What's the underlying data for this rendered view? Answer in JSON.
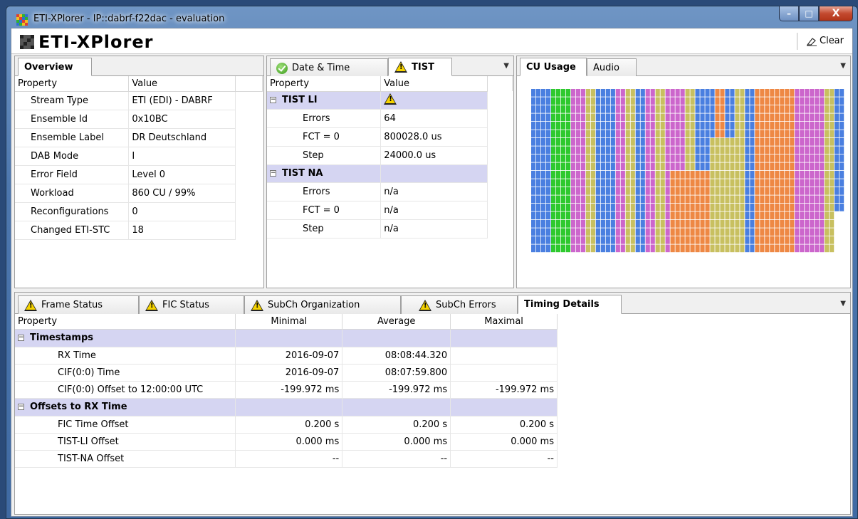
{
  "window": {
    "title": "ETI-XPlorer - IP::dabrf-f22dac - evaluation",
    "minimize": "–",
    "maximize": "□",
    "close": "X"
  },
  "header": {
    "logo_text": "ETI-XPlorer",
    "clear_label": "Clear"
  },
  "overview": {
    "tab": "Overview",
    "col_property": "Property",
    "col_value": "Value",
    "rows": [
      {
        "property": "Stream Type",
        "value": "ETI (EDI) - DABRF"
      },
      {
        "property": "Ensemble Id",
        "value": "0x10BC"
      },
      {
        "property": "Ensemble Label",
        "value": "DR Deutschland"
      },
      {
        "property": "DAB Mode",
        "value": "I"
      },
      {
        "property": "Error Field",
        "value": "Level 0"
      },
      {
        "property": "Workload",
        "value": "860 CU / 99%"
      },
      {
        "property": "Reconfigurations",
        "value": "0"
      },
      {
        "property": "Changed ETI-STC",
        "value": "18"
      }
    ]
  },
  "tist": {
    "tabs": [
      "Date & Time",
      "TIST"
    ],
    "col_property": "Property",
    "col_value": "Value",
    "group1": {
      "label": "TIST LI",
      "rows": [
        {
          "property": "Errors",
          "value": "64"
        },
        {
          "property": "FCT = 0",
          "value": "800028.0 us"
        },
        {
          "property": "Step",
          "value": "24000.0 us"
        }
      ]
    },
    "group2": {
      "label": "TIST NA",
      "rows": [
        {
          "property": "Errors",
          "value": "n/a"
        },
        {
          "property": "FCT = 0",
          "value": "n/a"
        },
        {
          "property": "Step",
          "value": "n/a"
        }
      ]
    }
  },
  "cu": {
    "tabs": [
      "CU Usage",
      "Audio"
    ],
    "colors": [
      "#4a7fe0",
      "#2ec92e",
      "#cc66cc",
      "#c8c060",
      "#ee8844",
      "#ffffff"
    ]
  },
  "timing": {
    "tabs": [
      "Frame Status",
      "FIC Status",
      "SubCh Organization",
      "SubCh Errors",
      "Timing Details"
    ],
    "columns": [
      "Property",
      "Minimal",
      "Average",
      "Maximal"
    ],
    "groups": [
      {
        "label": "Timestamps",
        "rows": [
          {
            "property": "RX Time",
            "min": "2016-09-07",
            "avg": "08:08:44.320",
            "max": ""
          },
          {
            "property": "CIF(0:0) Time",
            "min": "2016-09-07",
            "avg": "08:07:59.800",
            "max": ""
          },
          {
            "property": "CIF(0:0) Offset to 12:00:00 UTC",
            "min": "-199.972 ms",
            "avg": "-199.972 ms",
            "max": "-199.972 ms"
          }
        ]
      },
      {
        "label": "Offsets to RX Time",
        "rows": [
          {
            "property": "FIC Time Offset",
            "min": "0.200 s",
            "avg": "0.200 s",
            "max": "0.200 s"
          },
          {
            "property": "TIST-LI Offset",
            "min": "0.000 ms",
            "avg": "0.000 ms",
            "max": "0.000 ms"
          },
          {
            "property": "TIST-NA Offset",
            "min": "--",
            "avg": "--",
            "max": "--"
          }
        ]
      }
    ]
  }
}
